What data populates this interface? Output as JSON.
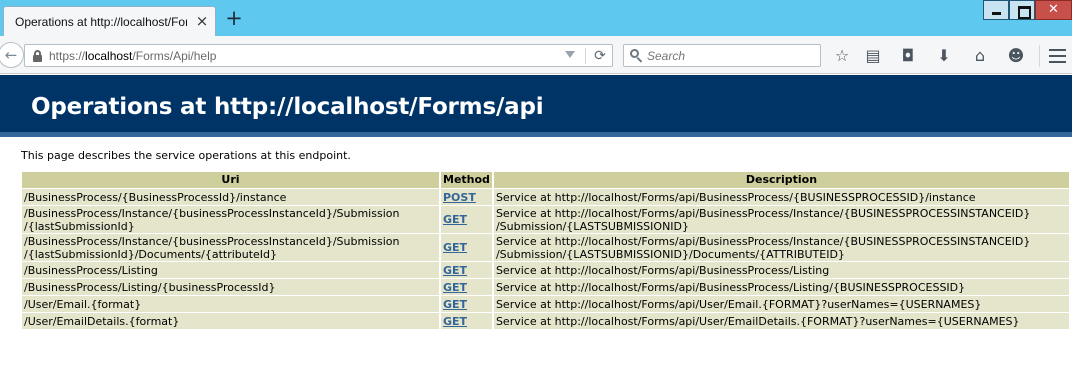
{
  "browser": {
    "tab_title": "Operations at http://localhost/Forms/api",
    "tab_close": "×",
    "new_tab": "+",
    "url_prefix": "https://",
    "url_host": "localhost",
    "url_path": "/Forms/Api/help",
    "search_placeholder": "Search",
    "icons": {
      "back": "back-arrow-icon",
      "lock": "lock-icon",
      "reload": "reload-icon",
      "search": "search-icon",
      "bookmark": "star-icon",
      "reading_list": "clipboard-icon",
      "pocket": "pocket-icon",
      "downloads": "download-arrow-icon",
      "home": "home-icon",
      "hello": "chat-smiley-icon",
      "menu": "hamburger-menu-icon"
    }
  },
  "page": {
    "heading": "Operations at http://localhost/Forms/api",
    "intro": "This page describes the service operations at this endpoint.",
    "colors": {
      "header_bg": "#003366",
      "header_border": "#336699",
      "table_header_bg": "#cecf9c",
      "table_row_bg": "#e5e5cc",
      "link": "#336699"
    }
  },
  "table": {
    "headers": {
      "uri": "Uri",
      "method": "Method",
      "description": "Description"
    },
    "rows": [
      {
        "uri": [
          "/BusinessProcess/{BusinessProcessId}/instance"
        ],
        "method": "POST",
        "description": [
          "Service at http://localhost/Forms/api/BusinessProcess/{BUSINESSPROCESSID}/instance"
        ]
      },
      {
        "uri": [
          "/BusinessProcess/Instance/{businessProcessInstanceId}/Submission",
          "/{lastSubmissionId}"
        ],
        "method": "GET",
        "description": [
          "Service at http://localhost/Forms/api/BusinessProcess/Instance/{BUSINESSPROCESSINSTANCEID}",
          "/Submission/{LASTSUBMISSIONID}"
        ]
      },
      {
        "uri": [
          "/BusinessProcess/Instance/{businessProcessInstanceId}/Submission",
          "/{lastSubmissionId}/Documents/{attributeId}"
        ],
        "method": "GET",
        "description": [
          "Service at http://localhost/Forms/api/BusinessProcess/Instance/{BUSINESSPROCESSINSTANCEID}",
          "/Submission/{LASTSUBMISSIONID}/Documents/{ATTRIBUTEID}"
        ]
      },
      {
        "uri": [
          "/BusinessProcess/Listing"
        ],
        "method": "GET",
        "description": [
          "Service at http://localhost/Forms/api/BusinessProcess/Listing"
        ]
      },
      {
        "uri": [
          "/BusinessProcess/Listing/{businessProcessId}"
        ],
        "method": "GET",
        "description": [
          "Service at http://localhost/Forms/api/BusinessProcess/Listing/{BUSINESSPROCESSID}"
        ]
      },
      {
        "uri": [
          "/User/Email.{format}"
        ],
        "method": "GET",
        "description": [
          "Service at http://localhost/Forms/api/User/Email.{FORMAT}?userNames={USERNAMES}"
        ]
      },
      {
        "uri": [
          "/User/EmailDetails.{format}"
        ],
        "method": "GET",
        "description": [
          "Service at http://localhost/Forms/api/User/EmailDetails.{FORMAT}?userNames={USERNAMES}"
        ]
      }
    ]
  }
}
